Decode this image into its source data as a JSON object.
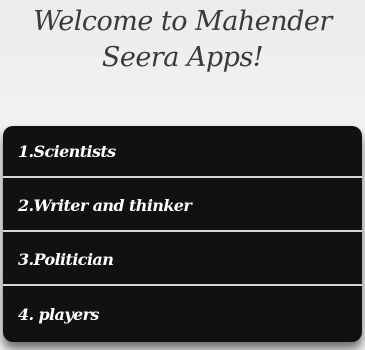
{
  "header": {
    "title": "Welcome to Mahender Seera Apps!"
  },
  "menu": {
    "items": [
      {
        "label": "1.Scientists"
      },
      {
        "label": "2.Writer and thinker"
      },
      {
        "label": "3.Politician"
      },
      {
        "label": "4. players"
      }
    ]
  }
}
